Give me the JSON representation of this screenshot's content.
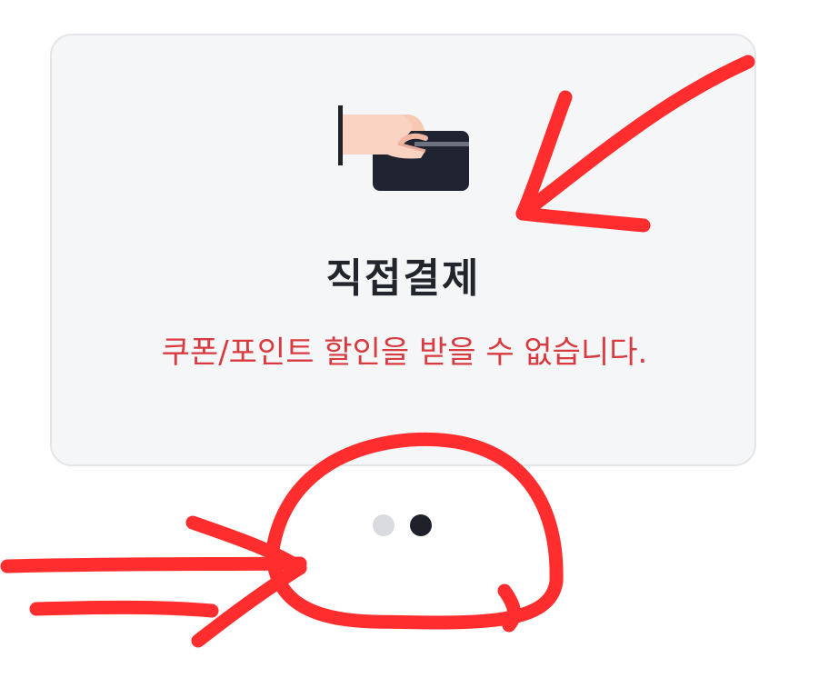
{
  "payment_option": {
    "icon": "hand-card-icon",
    "title": "직접결제",
    "description": "쿠폰/포인트 할인을 받을 수 없습니다."
  },
  "pager": {
    "total": 2,
    "active_index": 1
  },
  "colors": {
    "card_background": "#f5f6f8",
    "title": "#22252b",
    "description": "#d83a3f",
    "annotation": "#ff2d2d",
    "dot_inactive": "#d9dbde",
    "dot_active": "#1e2129"
  }
}
